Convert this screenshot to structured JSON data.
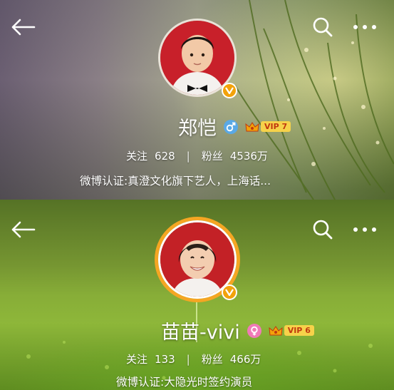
{
  "profiles": [
    {
      "name": "郑恺",
      "gender_icon": "male-symbol-icon",
      "gender_color": "#5aa9e6",
      "vip_level": "VIP 7",
      "follow_label": "关注",
      "follow_count": "628",
      "fans_label": "粉丝",
      "fans_count": "4536万",
      "certification": "微博认证:真澄文化旗下艺人，上海话..."
    },
    {
      "name": "苗苗-vivi",
      "gender_icon": "female-symbol-icon",
      "gender_color": "#f07ab8",
      "vip_level": "VIP 6",
      "follow_label": "关注",
      "follow_count": "133",
      "fans_label": "粉丝",
      "fans_count": "466万",
      "certification": "微博认证:大隐光时签约演员"
    }
  ],
  "colors": {
    "verified_badge": "#f2a20a",
    "vip_gold": "#f6d24a",
    "avatar_ring": "#f5a623"
  }
}
